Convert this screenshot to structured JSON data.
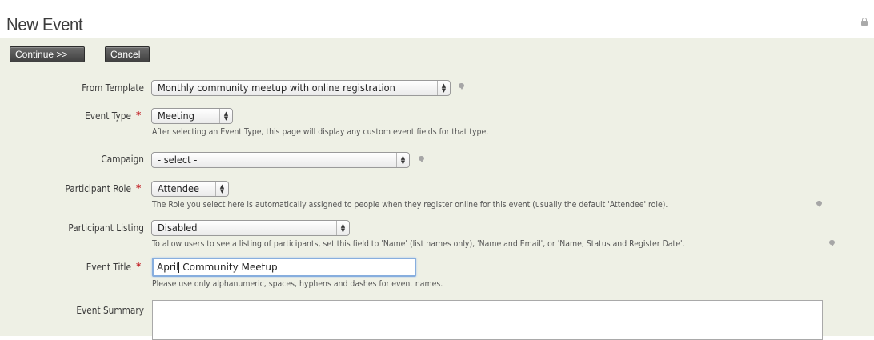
{
  "header": {
    "title": "New Event",
    "lock_icon": "lock-icon"
  },
  "actions": {
    "continue_label": "Continue >>",
    "cancel_label": "Cancel"
  },
  "form": {
    "from_template": {
      "label": "From Template",
      "value": "Monthly community meetup with online registration",
      "help_icon": "help-bubble-icon"
    },
    "event_type": {
      "label": "Event Type",
      "required_marker": "*",
      "value": "Meeting",
      "hint": "After selecting an Event Type, this page will display any custom event fields for that type."
    },
    "campaign": {
      "label": "Campaign",
      "value": "- select -",
      "help_icon": "help-bubble-icon"
    },
    "participant_role": {
      "label": "Participant Role",
      "required_marker": "*",
      "value": "Attendee",
      "hint": "The Role you select here is automatically assigned to people when they register online for this event (usually the default 'Attendee' role).",
      "help_icon": "help-bubble-icon"
    },
    "participant_listing": {
      "label": "Participant Listing",
      "value": "Disabled",
      "hint": "To allow users to see a listing of participants, set this field to 'Name' (list names only), 'Name and Email', or 'Name, Status and Register Date'.",
      "help_icon": "help-bubble-icon"
    },
    "event_title": {
      "label": "Event Title",
      "required_marker": "*",
      "value_before_caret": "April",
      "value_after_caret": " Community Meetup",
      "hint": "Please use only alphanumeric, spaces, hyphens and dashes for event names."
    },
    "event_summary": {
      "label": "Event Summary",
      "value": ""
    }
  }
}
